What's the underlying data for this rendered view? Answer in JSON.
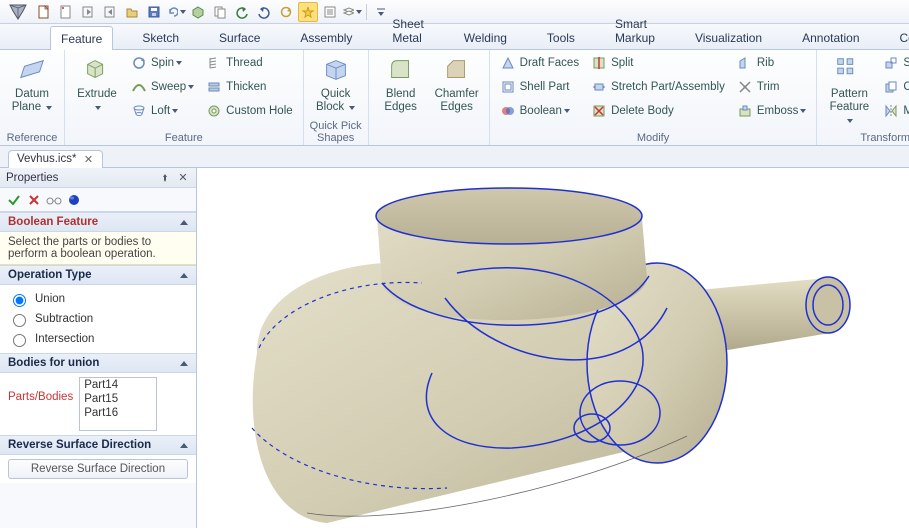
{
  "qat_icons": [
    "new-doc",
    "open-doc",
    "save",
    "export",
    "folder",
    "disk",
    "undo-dd",
    "object",
    "copy",
    "undo",
    "redo",
    "refresh",
    "highlight",
    "list",
    "layers"
  ],
  "tabs": {
    "items": [
      "Feature",
      "Sketch",
      "Surface",
      "Assembly",
      "Sheet Metal",
      "Welding",
      "Tools",
      "Smart Markup",
      "Visualization",
      "Annotation",
      "Common"
    ],
    "active_index": 0
  },
  "ribbon": {
    "groups": [
      {
        "label": "Reference",
        "big": [
          {
            "name": "datum-plane",
            "label": "Datum\nPlane",
            "dd": true
          }
        ]
      },
      {
        "label": "Feature",
        "big": [
          {
            "name": "extrude",
            "label": "Extrude",
            "dd": true
          }
        ],
        "cols": [
          [
            {
              "name": "spin",
              "label": "Spin",
              "dd": true
            },
            {
              "name": "sweep",
              "label": "Sweep",
              "dd": true
            },
            {
              "name": "loft",
              "label": "Loft",
              "dd": true
            }
          ],
          [
            {
              "name": "thread",
              "label": "Thread"
            },
            {
              "name": "thicken",
              "label": "Thicken"
            },
            {
              "name": "custom-hole",
              "label": "Custom Hole"
            }
          ]
        ]
      },
      {
        "label": "Quick Pick Shapes",
        "big": [
          {
            "name": "quick-block",
            "label": "Quick\nBlock",
            "dd": true
          }
        ]
      },
      {
        "label": "",
        "big": [
          {
            "name": "blend-edges",
            "label": "Blend\nEdges"
          },
          {
            "name": "chamfer-edges",
            "label": "Chamfer\nEdges"
          }
        ]
      },
      {
        "label": "Modify",
        "cols": [
          [
            {
              "name": "draft-faces",
              "label": "Draft Faces"
            },
            {
              "name": "shell-part",
              "label": "Shell Part"
            },
            {
              "name": "boolean",
              "label": "Boolean",
              "dd": true
            }
          ],
          [
            {
              "name": "split",
              "label": "Split"
            },
            {
              "name": "stretch-part-assembly",
              "label": "Stretch Part/Assembly"
            },
            {
              "name": "delete-body",
              "label": "Delete Body"
            }
          ],
          [
            {
              "name": "rib",
              "label": "Rib"
            },
            {
              "name": "trim",
              "label": "Trim"
            },
            {
              "name": "emboss",
              "label": "Emboss",
              "dd": true
            }
          ]
        ]
      },
      {
        "label": "Transform",
        "big": [
          {
            "name": "pattern-feature",
            "label": "Pattern\nFeature",
            "dd": true
          }
        ],
        "cols": [
          [
            {
              "name": "scale-body",
              "label": "Scale B"
            },
            {
              "name": "copy-body",
              "label": "Copy B"
            },
            {
              "name": "mirror",
              "label": "Mirror",
              "dd": true
            }
          ]
        ]
      }
    ]
  },
  "doc_tab": {
    "label": "Vevhus.ics*"
  },
  "panel": {
    "title": "Properties",
    "feature_name": "Boolean Feature",
    "hint": "Select the parts or bodies to perform a boolean operation.",
    "operation_type": {
      "label": "Operation Type",
      "options": [
        "Union",
        "Subtraction",
        "Intersection"
      ],
      "selected_index": 0
    },
    "bodies": {
      "label": "Bodies for union",
      "field_label": "Parts/Bodies",
      "items": [
        "Part14",
        "Part15",
        "Part16"
      ]
    },
    "reverse": {
      "label": "Reverse Surface Direction",
      "button": "Reverse Surface Direction"
    }
  },
  "colors": {
    "edge": "#2030d0",
    "shade_light": "#e2ddc6",
    "shade_mid": "#cfc9ae",
    "shade_dark": "#b5ad8f"
  }
}
